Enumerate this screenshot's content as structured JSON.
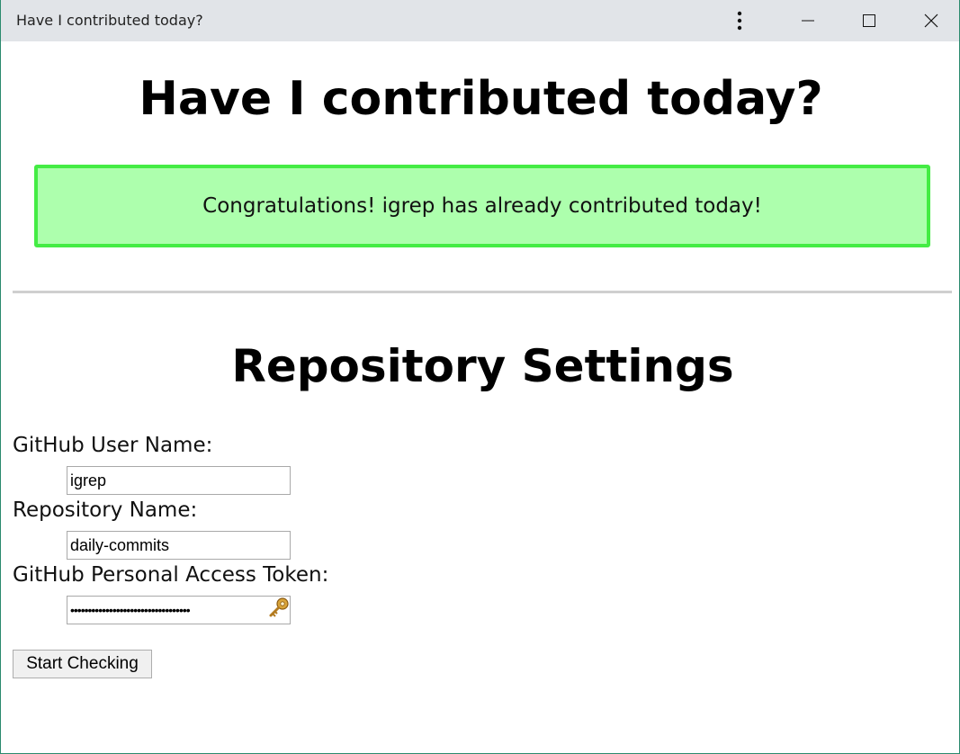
{
  "window": {
    "title": "Have I contributed today?"
  },
  "header": {
    "title": "Have I contributed today?"
  },
  "status": {
    "message": "Congratulations! igrep has already contributed today!",
    "background_color": "#adffad",
    "border_color": "#44ec44"
  },
  "settings": {
    "title": "Repository Settings",
    "username": {
      "label": "GitHub User Name:",
      "value": "igrep"
    },
    "repository": {
      "label": "Repository Name:",
      "value": "daily-commits"
    },
    "token": {
      "label": "GitHub Personal Access Token:",
      "masked_value": "••••••••••••••••••••••••••••••••••"
    },
    "start_button_label": "Start Checking"
  },
  "icons": {
    "more": "more-vertical-icon",
    "minimize": "minimize-icon",
    "maximize": "maximize-icon",
    "close": "close-icon",
    "password_manager": "key-icon"
  }
}
